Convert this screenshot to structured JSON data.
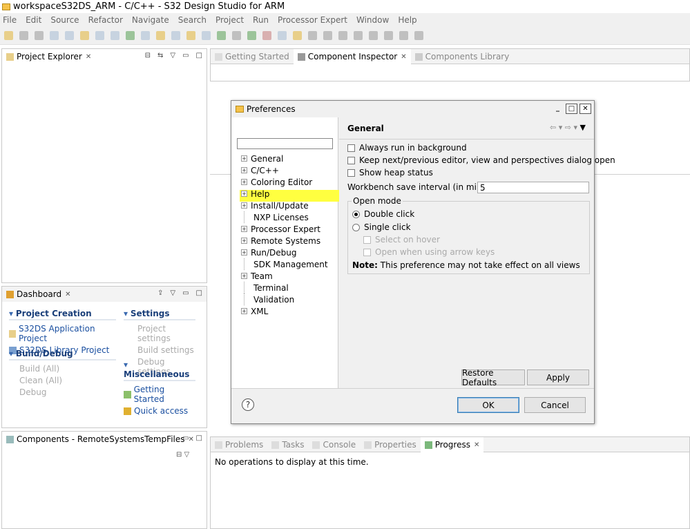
{
  "window": {
    "title": "workspaceS32DS_ARM - C/C++ - S32 Design Studio for ARM"
  },
  "menu": [
    "File",
    "Edit",
    "Source",
    "Refactor",
    "Navigate",
    "Search",
    "Project",
    "Run",
    "Processor Expert",
    "Window",
    "Help"
  ],
  "project_explorer": {
    "tab": "Project Explorer"
  },
  "editor_tabs": [
    {
      "label": "Getting Started",
      "active": false
    },
    {
      "label": "Component Inspector",
      "active": true
    },
    {
      "label": "Components Library",
      "active": false
    }
  ],
  "dashboard": {
    "tab": "Dashboard",
    "project_creation": {
      "title": "Project Creation",
      "items": [
        "S32DS Application Project",
        "S32DS Library Project"
      ]
    },
    "build_debug": {
      "title": "Build/Debug",
      "items": [
        "Build  (All)",
        "Clean  (All)",
        "Debug"
      ]
    },
    "settings": {
      "title": "Settings",
      "items": [
        "Project settings",
        "Build settings",
        "Debug settings"
      ]
    },
    "misc": {
      "title": "Miscellaneous",
      "items": [
        "Getting Started",
        "Quick access"
      ]
    }
  },
  "components": {
    "tab": "Components - RemoteSystemsTempFiles"
  },
  "bottom_tabs": [
    {
      "label": "Problems",
      "active": false
    },
    {
      "label": "Tasks",
      "active": false
    },
    {
      "label": "Console",
      "active": false
    },
    {
      "label": "Properties",
      "active": false
    },
    {
      "label": "Progress",
      "active": true
    }
  ],
  "progress": {
    "message": "No operations to display at this time."
  },
  "dialog": {
    "title": "Preferences",
    "filter_value": "",
    "tree": [
      {
        "label": "General",
        "expandable": true
      },
      {
        "label": "C/C++",
        "expandable": true
      },
      {
        "label": "Coloring Editor",
        "expandable": true
      },
      {
        "label": "Help",
        "expandable": true,
        "highlighted": true
      },
      {
        "label": "Install/Update",
        "expandable": true
      },
      {
        "label": "NXP Licenses",
        "expandable": false
      },
      {
        "label": "Processor Expert",
        "expandable": true
      },
      {
        "label": "Remote Systems",
        "expandable": true
      },
      {
        "label": "Run/Debug",
        "expandable": true
      },
      {
        "label": "SDK Management",
        "expandable": false
      },
      {
        "label": "Team",
        "expandable": true
      },
      {
        "label": "Terminal",
        "expandable": false
      },
      {
        "label": "Validation",
        "expandable": false
      },
      {
        "label": "XML",
        "expandable": true
      }
    ],
    "page_title": "General",
    "options": {
      "always_run_bg": "Always run in background",
      "keep_next_prev": "Keep next/previous editor, view and perspectives dialog open",
      "show_heap": "Show heap status",
      "save_interval_label": "Workbench save interval (in minutes):",
      "save_interval_value": "5"
    },
    "open_mode": {
      "legend": "Open mode",
      "double_click": "Double click",
      "single_click": "Single click",
      "select_on_hover": "Select on hover",
      "open_arrow_keys": "Open when using arrow keys",
      "note_bold": "Note:",
      "note_text": "This preference may not take effect on all views"
    },
    "buttons": {
      "restore": "Restore Defaults",
      "apply": "Apply",
      "ok": "OK",
      "cancel": "Cancel",
      "help": "?"
    }
  }
}
